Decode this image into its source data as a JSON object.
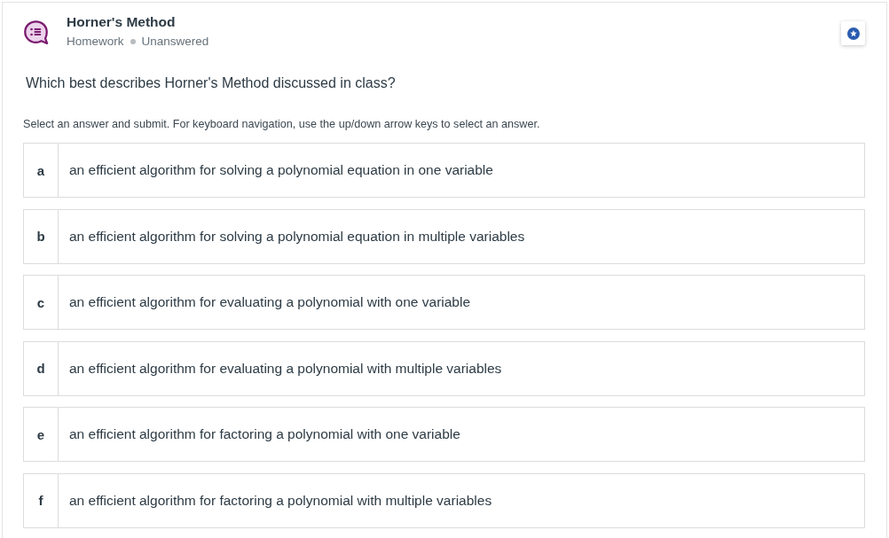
{
  "header": {
    "title": "Horner's Method",
    "category": "Homework",
    "status": "Unanswered"
  },
  "question": "Which best describes Horner's Method discussed in class?",
  "instructions": "Select an answer and submit. For keyboard navigation, use the up/down arrow keys to select an answer.",
  "options": [
    {
      "letter": "a",
      "text": "an efficient algorithm for solving a polynomial equation in one variable",
      "selected": false
    },
    {
      "letter": "b",
      "text": "an efficient algorithm for solving a polynomial equation in multiple variables",
      "selected": false
    },
    {
      "letter": "c",
      "text": "an efficient algorithm for evaluating a polynomial with one variable",
      "selected": false
    },
    {
      "letter": "d",
      "text": "an efficient algorithm for evaluating a polynomial with multiple variables",
      "selected": false
    },
    {
      "letter": "e",
      "text": "an efficient algorithm for factoring a polynomial with one variable",
      "selected": false
    },
    {
      "letter": "f",
      "text": "an efficient algorithm for factoring a polynomial with multiple variables",
      "selected": false
    }
  ]
}
